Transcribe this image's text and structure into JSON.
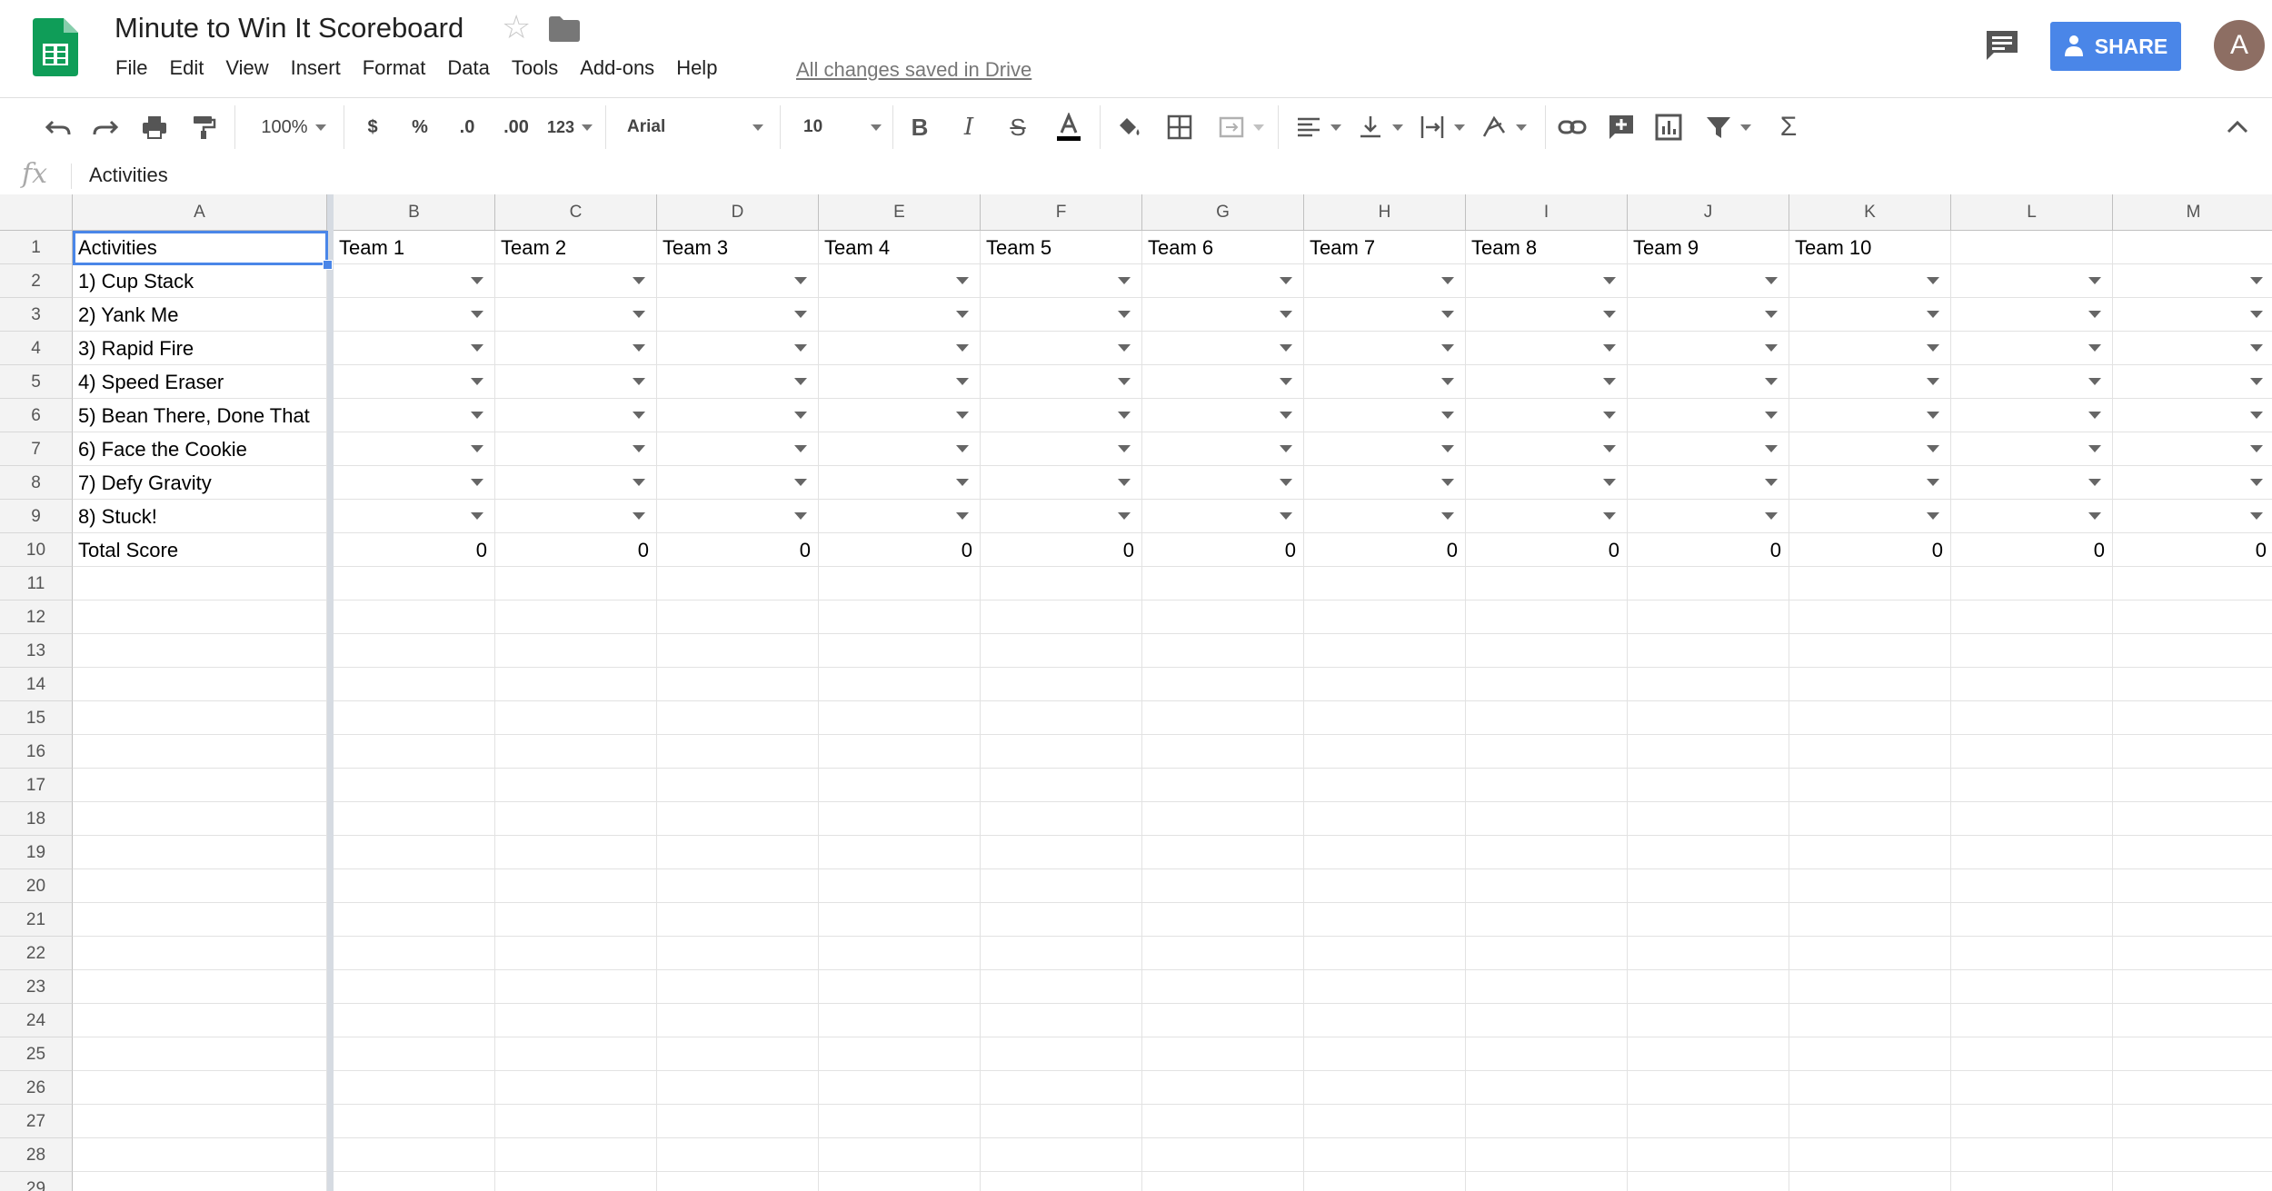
{
  "app": {
    "doc_title": "Minute to Win It Scoreboard",
    "save_status": "All changes saved in Drive",
    "share_label": "SHARE",
    "avatar_letter": "A",
    "brand_color": "#0f9d58",
    "accent_color": "#4a86e8"
  },
  "menu": [
    "File",
    "Edit",
    "View",
    "Insert",
    "Format",
    "Data",
    "Tools",
    "Add-ons",
    "Help"
  ],
  "toolbar": {
    "zoom": "100%",
    "currency": "$",
    "percent": "%",
    "decrease_decimal": ".0",
    "increase_decimal": ".00",
    "number_format": "123",
    "font": "Arial",
    "font_size": "10",
    "icons": [
      "undo-icon",
      "redo-icon",
      "print-icon",
      "paint-format-icon",
      "bold-icon",
      "italic-icon",
      "strikethrough-icon",
      "text-color-icon",
      "fill-color-icon",
      "borders-icon",
      "merge-icon",
      "align-icon",
      "valign-icon",
      "wrap-icon",
      "rotate-icon",
      "link-icon",
      "comment-add-icon",
      "chart-icon",
      "filter-icon",
      "functions-icon",
      "collapse-icon"
    ]
  },
  "formula_bar": {
    "fx": "fx",
    "value": "Activities"
  },
  "sheet": {
    "columns": [
      "A",
      "B",
      "C",
      "D",
      "E",
      "F",
      "G",
      "H",
      "I",
      "J",
      "K",
      "L",
      "M"
    ],
    "rows": [
      "1",
      "2",
      "3",
      "4",
      "5",
      "6",
      "7",
      "8",
      "9",
      "10",
      "11",
      "12",
      "13",
      "14",
      "15",
      "16",
      "17",
      "18",
      "19",
      "20",
      "21",
      "22",
      "23",
      "24",
      "25",
      "26",
      "27",
      "28",
      "29"
    ],
    "header_row": [
      "Activities",
      "Team 1",
      "Team 2",
      "Team 3",
      "Team 4",
      "Team 5",
      "Team 6",
      "Team 7",
      "Team 8",
      "Team 9",
      "Team 10",
      "",
      ""
    ],
    "activities": [
      "1) Cup Stack",
      "2) Yank Me",
      "3) Rapid Fire",
      "4) Speed Eraser",
      "5) Bean There, Done That",
      "6) Face the Cookie",
      "7) Defy Gravity",
      "8) Stuck!"
    ],
    "total_label": "Total Score",
    "totals": [
      "0",
      "0",
      "0",
      "0",
      "0",
      "0",
      "0",
      "0",
      "0",
      "0",
      "0",
      "0"
    ],
    "selected_cell": "A1"
  }
}
